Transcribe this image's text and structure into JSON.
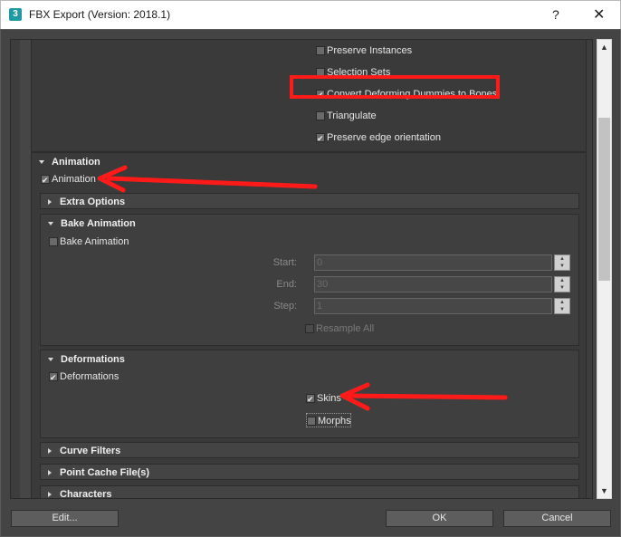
{
  "window": {
    "app_icon_glyph": "3",
    "title": "FBX Export (Version: 2018.1)",
    "help_label": "?",
    "close_label": "✕"
  },
  "geometry_options": {
    "preserve_instances": {
      "label": "Preserve Instances",
      "checked": false
    },
    "selection_sets": {
      "label": "Selection Sets",
      "checked": false
    },
    "convert_dummies": {
      "label": "Convert Deforming Dummies to Bones",
      "checked": true
    },
    "triangulate": {
      "label": "Triangulate",
      "checked": false
    },
    "preserve_edge": {
      "label": "Preserve edge orientation",
      "checked": true
    }
  },
  "animation": {
    "title": "Animation",
    "checkbox": {
      "label": "Animation",
      "checked": true
    },
    "extra_options": {
      "title": "Extra Options"
    },
    "bake": {
      "title": "Bake Animation",
      "checkbox": {
        "label": "Bake Animation",
        "checked": false
      },
      "start": {
        "label": "Start:",
        "value": "0"
      },
      "end": {
        "label": "End:",
        "value": "30"
      },
      "step": {
        "label": "Step:",
        "value": "1"
      },
      "resample": {
        "label": "Resample All",
        "checked": false
      }
    },
    "deformations": {
      "title": "Deformations",
      "checkbox": {
        "label": "Deformations",
        "checked": true
      },
      "skins": {
        "label": "Skins",
        "checked": true
      },
      "morphs": {
        "label": "Morphs",
        "checked": false
      }
    },
    "curve_filters": {
      "title": "Curve Filters"
    },
    "point_cache": {
      "title": "Point Cache File(s)"
    },
    "characters": {
      "title": "Characters"
    }
  },
  "footer": {
    "edit_label": "Edit...",
    "ok_label": "OK",
    "cancel_label": "Cancel"
  },
  "scrollbar": {
    "up_glyph": "▲",
    "down_glyph": "▼"
  },
  "colors": {
    "annotation": "#ff1a1a",
    "panel": "#444444"
  }
}
